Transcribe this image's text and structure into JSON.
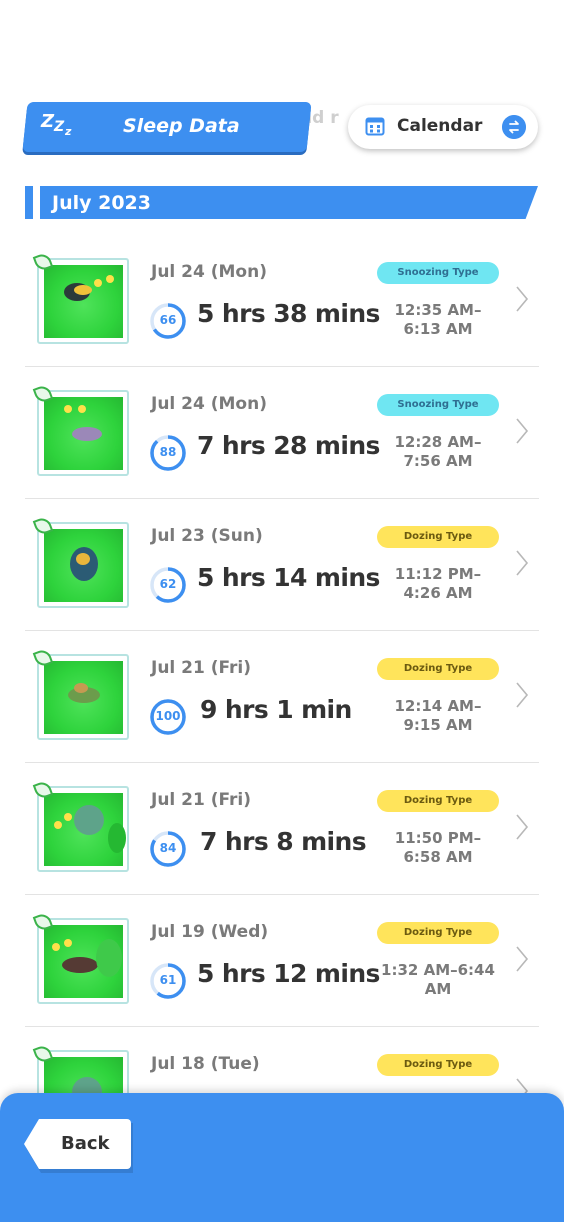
{
  "header": {
    "title": "Sleep Data",
    "ghost_text": "nd r",
    "calendar_label": "Calendar"
  },
  "month": "July 2023",
  "colors": {
    "accent": "#3d8ff0",
    "snoozing_badge": "#6fe6f2",
    "dozing_badge": "#ffe45b",
    "grass": "#2ed33c"
  },
  "records": [
    {
      "date": "Jul 24 (Mon)",
      "score": "66",
      "score_value": 66,
      "duration": "5 hrs 38 mins",
      "type": "Snoozing Type",
      "time": "12:35 AM–6:13 AM"
    },
    {
      "date": "Jul 24 (Mon)",
      "score": "88",
      "score_value": 88,
      "duration": "7 hrs 28 mins",
      "type": "Snoozing Type",
      "time": "12:28 AM–7:56 AM"
    },
    {
      "date": "Jul 23 (Sun)",
      "score": "62",
      "score_value": 62,
      "duration": "5 hrs 14 mins",
      "type": "Dozing Type",
      "time": "11:12 PM–4:26 AM"
    },
    {
      "date": "Jul 21 (Fri)",
      "score": "100",
      "score_value": 100,
      "duration": "9 hrs 1 min",
      "type": "Dozing Type",
      "time": "12:14 AM–9:15 AM"
    },
    {
      "date": "Jul 21 (Fri)",
      "score": "84",
      "score_value": 84,
      "duration": "7 hrs 8 mins",
      "type": "Dozing Type",
      "time": "11:50 PM–6:58 AM"
    },
    {
      "date": "Jul 19 (Wed)",
      "score": "61",
      "score_value": 61,
      "duration": "5 hrs 12 mins",
      "type": "Dozing Type",
      "time": "1:32 AM–6:44 AM"
    },
    {
      "date": "Jul 18 (Tue)",
      "type": "Dozing Type"
    }
  ],
  "footer": {
    "back_label": "Back"
  }
}
